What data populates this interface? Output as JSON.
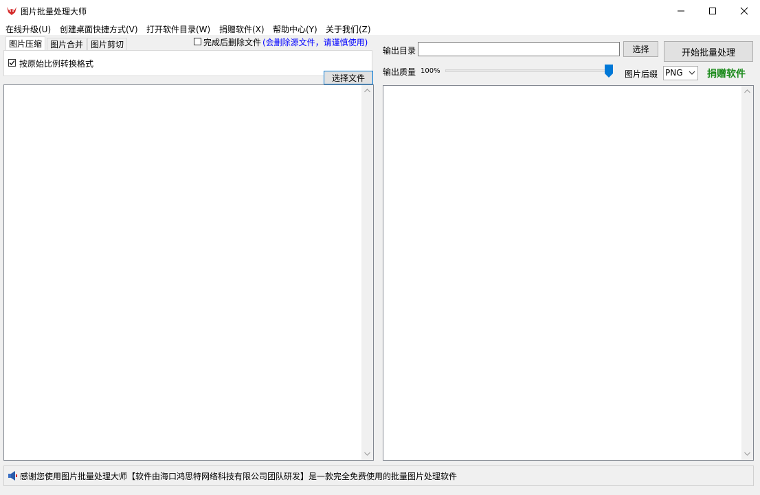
{
  "window": {
    "title": "图片批量处理大师"
  },
  "menu": {
    "items": [
      "在线升级(U)",
      "创建桌面快捷方式(V)",
      "打开软件目录(W)",
      "捐赠软件(X)",
      "帮助中心(Y)",
      "关于我们(Z)"
    ]
  },
  "tabs": [
    "图片压缩",
    "图片合并",
    "图片剪切"
  ],
  "options": {
    "delete_after_label": "完成后删除文件",
    "delete_after_warning": "(会删除源文件，请谨慎使用)",
    "delete_after_checked": false,
    "keep_ratio_label": "按原始比例转换格式",
    "keep_ratio_checked": true
  },
  "select_file_button": "选择文件",
  "output": {
    "dir_label": "输出目录",
    "dir_value": "",
    "choose_button": "选择",
    "start_button": "开始批量处理",
    "quality_label": "输出质量",
    "quality_value": "100%",
    "quality_level": 1.0,
    "suffix_label": "图片后缀",
    "suffix_value": "PNG",
    "donate_link": "捐赠软件"
  },
  "status": {
    "text": "感谢您使用图片批量处理大师【软件由海口鸿思特网络科技有限公司团队研发】是一款完全免费使用的批量图片处理软件"
  },
  "colors": {
    "link_blue": "#0000ff",
    "donate_green": "#1a8a1a",
    "slider_blue": "#0078d7"
  }
}
